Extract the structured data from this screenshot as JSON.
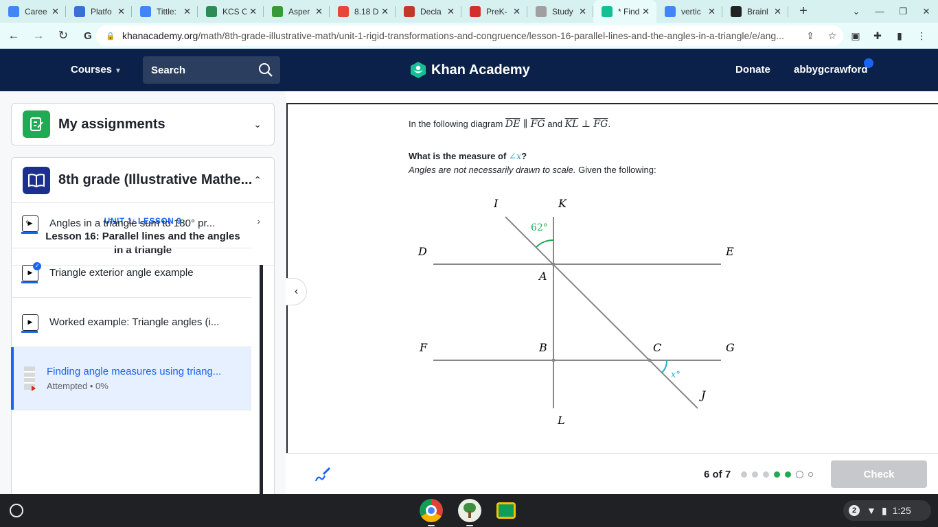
{
  "browser": {
    "tabs": [
      {
        "title": "Caree",
        "icon": "docs-icon",
        "color": "#4285f4"
      },
      {
        "title": "Platfo",
        "icon": "platform-icon",
        "color": "#3b6fd8"
      },
      {
        "title": "Tittle:",
        "icon": "docs-icon",
        "color": "#4285f4"
      },
      {
        "title": "KCS C",
        "icon": "kcs-icon",
        "color": "#2e8b57"
      },
      {
        "title": "Asper",
        "icon": "leaf-icon",
        "color": "#3a9a3a"
      },
      {
        "title": "8.18 D",
        "icon": "ring-icon",
        "color": "#e8453c"
      },
      {
        "title": "Decla",
        "icon": "sheet-icon",
        "color": "#c0392b"
      },
      {
        "title": "PreK-",
        "icon": "m-icon",
        "color": "#d32f2f"
      },
      {
        "title": "Study",
        "icon": "quizlet-icon",
        "color": "#a0a0a0"
      },
      {
        "title": "* Find",
        "icon": "khan-icon",
        "color": "#14bf96"
      },
      {
        "title": "vertic",
        "icon": "google-icon",
        "color": "#4285f4"
      },
      {
        "title": "Brainl",
        "icon": "brainly-icon",
        "color": "#222222"
      }
    ],
    "url_domain": "khanacademy.org",
    "url_path": "/math/8th-grade-illustrative-math/unit-1-rigid-transformations-and-congruence/lesson-16-parallel-lines-and-the-angles-in-a-triangle/e/ang..."
  },
  "header": {
    "courses_label": "Courses",
    "search_label": "Search",
    "logo_text": "Khan Academy",
    "donate_label": "Donate",
    "username": "abbygcrawford"
  },
  "sidebar": {
    "assignments_label": "My assignments",
    "course_title": "8th grade (Illustrative Mathe...",
    "unit_label": "UNIT 1: LESSON 9",
    "lesson_title": "Lesson 16: Parallel lines and the angles in a triangle",
    "items": [
      {
        "label": "Angles in a triangle sum to 180° pr...",
        "kind": "video"
      },
      {
        "label": "Triangle exterior angle example",
        "kind": "video",
        "completed": true
      },
      {
        "label": "Worked example: Triangle angles (i...",
        "kind": "video"
      },
      {
        "label": "Finding angle measures using triang...",
        "kind": "exercise",
        "status": "Attempted • 0%"
      }
    ]
  },
  "question": {
    "line1_prefix": "In the following diagram ",
    "seg1": "DE",
    "parallel": " ∥ ",
    "seg2": "FG",
    "and_text": " and ",
    "seg3": "KL",
    "perp": " ⊥ ",
    "seg4": "FG",
    "period": ".",
    "ask_prefix": "What is the measure of ",
    "ask_angle": "∠x",
    "ask_suffix": "?",
    "note_italic": "Angles are not necessarily drawn to scale.",
    "note_rest": " Given the following:"
  },
  "diagram": {
    "points": {
      "I": "I",
      "K": "K",
      "D": "D",
      "E": "E",
      "A": "A",
      "F": "F",
      "B": "B",
      "C": "C",
      "G": "G",
      "J": "J",
      "L": "L"
    },
    "given_angle": "62°",
    "unknown_angle": "x°",
    "given_color": "#1fab54",
    "unknown_color": "#29abca"
  },
  "footer": {
    "progress_text": "6 of 7",
    "check_label": "Check"
  },
  "taskbar": {
    "time": "1:25",
    "notif_count": "2"
  }
}
